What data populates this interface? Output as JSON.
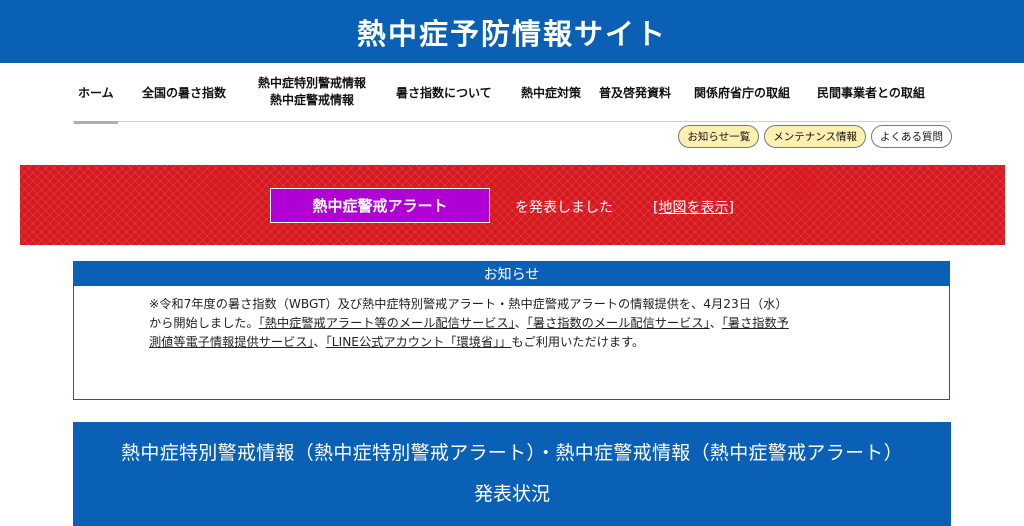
{
  "header": {
    "site_title": "熱中症予防情報サイト"
  },
  "nav": {
    "items": [
      {
        "label": "ホーム"
      },
      {
        "label": "全国の暑さ指数"
      },
      {
        "label_line1": "熱中症特別警戒情報",
        "label_line2": "熱中症警戒情報"
      },
      {
        "label": "暑さ指数について"
      },
      {
        "label": "熱中症対策"
      },
      {
        "label": "普及啓発資料"
      },
      {
        "label": "関係府省庁の取組"
      },
      {
        "label": "民間事業者との取組"
      }
    ]
  },
  "quick_links": {
    "news_list": "お知らせ一覧",
    "maintenance": "メンテナンス情報",
    "faq": "よくある質問"
  },
  "alert": {
    "box_label": "熱中症警戒アラート",
    "text": "を発表しました",
    "map_link": "[地図を表示]"
  },
  "notice": {
    "title": "お知らせ",
    "text_a": "※令和7年度の暑さ指数（WBGT）及び熱中症特別警戒アラート・熱中症警戒アラートの情報提供を、4月23日（水）から開始しました。",
    "link1": "「熱中症警戒アラート等のメール配信サービス」",
    "sep1": "、",
    "link2": "「暑さ指数のメール配信サービス」",
    "sep2": "、",
    "link3": "「暑さ指数予測値等電子情報提供サービス」",
    "sep3": "、",
    "link4": "「LINE公式アカウント「環境省」」",
    "text_b": "もご利用いただけます。"
  },
  "status": {
    "heading_line1": "熱中症特別警戒情報（熱中症特別警戒アラート）・熱中症警戒情報（熱中症警戒アラート）",
    "heading_line2": "発表状況"
  },
  "colors": {
    "brand_blue": "#0a60b5",
    "alert_red": "#d71920",
    "alert_purple": "#b000d6",
    "pill_yellow": "#fbefb2"
  }
}
